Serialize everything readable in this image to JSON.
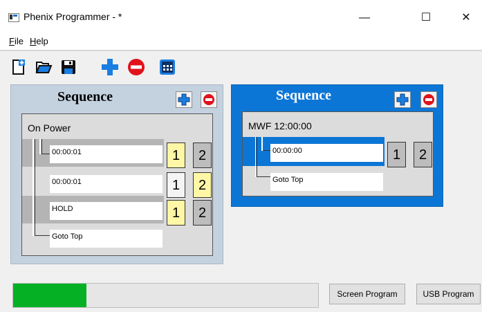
{
  "window": {
    "title": "Phenix Programmer - *",
    "minimize_glyph": "—",
    "maximize_glyph": "☐",
    "close_glyph": "✕"
  },
  "menu": {
    "items": [
      "File",
      "Help"
    ]
  },
  "toolbar": {
    "icons": [
      "new-file-icon",
      "open-folder-icon",
      "save-icon",
      "add-sequence-icon",
      "remove-sequence-icon",
      "calendar-icon"
    ]
  },
  "sequences": [
    {
      "title": "Sequence",
      "selected": false,
      "group_label": "On Power",
      "steps": [
        {
          "text": "00:00:01",
          "slots": [
            "1",
            "2"
          ],
          "active": [
            true,
            false
          ]
        },
        {
          "text": "00:00:01",
          "slots": [
            "1",
            "2"
          ],
          "active": [
            false,
            true
          ]
        },
        {
          "text": "HOLD",
          "slots": [
            "1",
            "2"
          ],
          "active": [
            true,
            false
          ]
        }
      ],
      "footer": "Goto Top"
    },
    {
      "title": "Sequence",
      "selected": true,
      "group_label": "MWF 12:00:00",
      "steps": [
        {
          "text": "00:00:00",
          "slots": [
            "1",
            "2"
          ],
          "active": [
            false,
            false
          ]
        }
      ],
      "footer": "Goto Top"
    }
  ],
  "status": {
    "progress_fraction": 0.24
  },
  "buttons": {
    "screen_program": "Screen Program",
    "usb_program": "USB Program"
  },
  "colors": {
    "accent": "#0c76d6",
    "active_slot": "#fff7a6",
    "progress": "#06b025",
    "delete_red": "#e0121b"
  }
}
